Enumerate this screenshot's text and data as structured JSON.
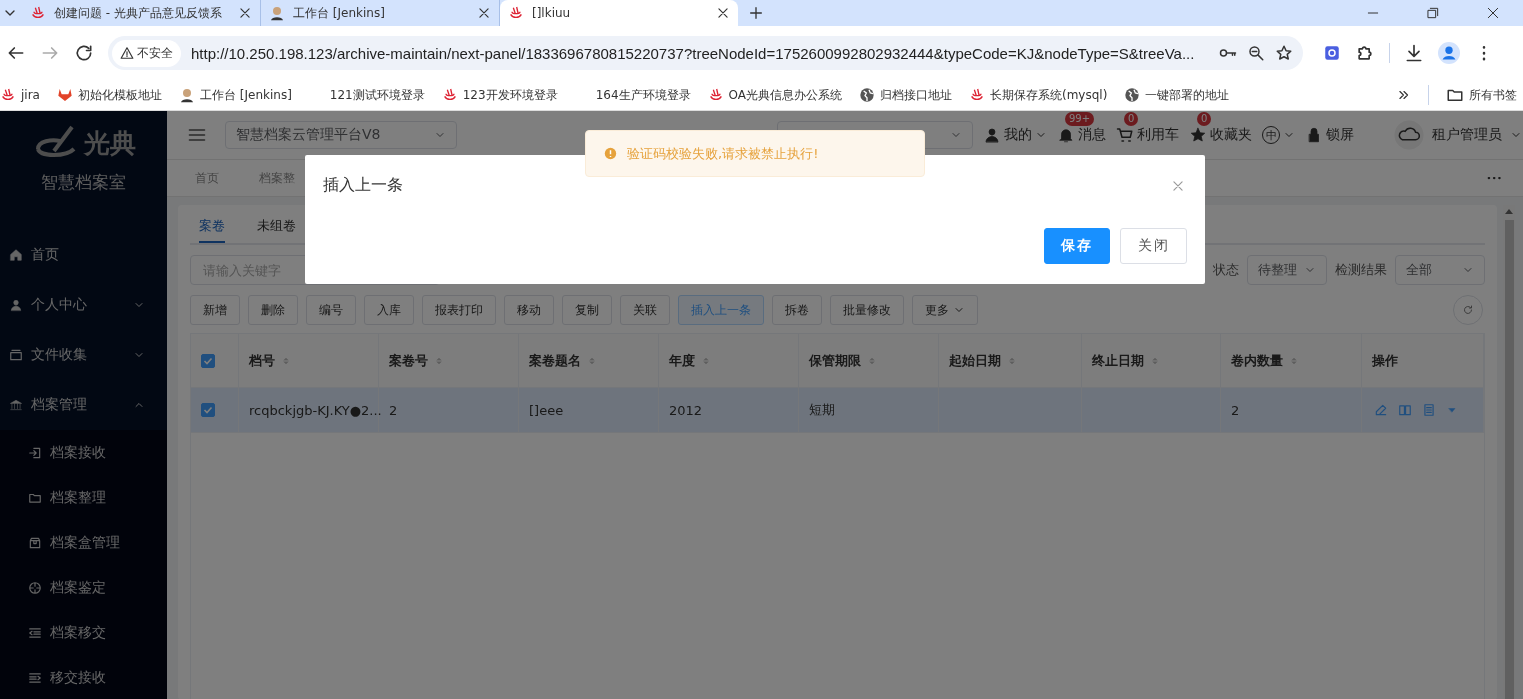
{
  "browser": {
    "tabs": [
      {
        "kind": "logo",
        "title": "创建问题 - 光典产品意见反馈系",
        "selected": false
      },
      {
        "kind": "avatar",
        "title": "工作台 [Jenkins]",
        "selected": false
      },
      {
        "kind": "logo",
        "title": "[]lkiuu",
        "selected": true
      }
    ],
    "security": "不安全",
    "url": "http://10.250.198.123/archive-maintain/next-panel/1833696780815220737?treeNodeId=1752600992802932444&typeCode=KJ&nodeType=S&treeVa...",
    "bookmarks": [
      {
        "kind": "logo",
        "label": "jira"
      },
      {
        "kind": "fox",
        "label": "初始化模板地址"
      },
      {
        "kind": "avatar",
        "label": "工作台 [Jenkins]"
      },
      {
        "kind": "none",
        "label": "121测试环境登录"
      },
      {
        "kind": "logo",
        "label": "123开发环境登录"
      },
      {
        "kind": "none",
        "label": "164生产环境登录"
      },
      {
        "kind": "logo",
        "label": "OA光典信息办公系统"
      },
      {
        "kind": "globe",
        "label": "归档接口地址"
      },
      {
        "kind": "logo",
        "label": "长期保存系统(mysql)"
      },
      {
        "kind": "globe",
        "label": "一键部署的地址"
      }
    ],
    "all_bookmarks": "所有书签"
  },
  "sidebar": {
    "logo": "光典",
    "title": "智慧档案室",
    "items": [
      {
        "kind": "home",
        "label": "首页"
      },
      {
        "kind": "person",
        "label": "个人中心",
        "expanded": false
      },
      {
        "kind": "tray",
        "label": "文件收集",
        "expanded": false
      },
      {
        "kind": "bank",
        "label": "档案管理",
        "expanded": true,
        "children": [
          {
            "kind": "enter",
            "label": "档案接收"
          },
          {
            "kind": "folder",
            "label": "档案整理"
          },
          {
            "kind": "box",
            "label": "档案盒管理"
          },
          {
            "kind": "crosshair",
            "label": "档案鉴定"
          },
          {
            "kind": "outdent",
            "label": "档案移交"
          },
          {
            "kind": "indent",
            "label": "移交接收"
          }
        ]
      }
    ]
  },
  "header": {
    "system": "智慧档案云管理平台V8",
    "menu": [
      {
        "kind": "user",
        "label": "我的",
        "dropdown": true
      },
      {
        "kind": "bell",
        "label": "消息",
        "badge": "99+"
      },
      {
        "kind": "cart",
        "label": "利用车",
        "badge": "0"
      },
      {
        "kind": "star",
        "label": "收藏夹",
        "badge": "0"
      },
      {
        "kind": "language",
        "label": "中",
        "dropdown": true
      },
      {
        "kind": "lock",
        "label": "锁屏"
      }
    ],
    "user": "租户管理员"
  },
  "page_tabs": [
    "首页",
    "档案整"
  ],
  "content": {
    "tabs": [
      {
        "label": "案卷",
        "selected": true
      },
      {
        "label": "未组卷",
        "selected": false
      }
    ],
    "search": {
      "placeholder": "请输入关键字"
    },
    "filters": [
      {
        "label": "状态",
        "value": "待整理"
      },
      {
        "label": "检测结果",
        "value": "全部"
      }
    ],
    "toolbar": [
      {
        "label": "新增",
        "selected": false
      },
      {
        "label": "删除",
        "selected": false
      },
      {
        "label": "编号",
        "selected": false
      },
      {
        "label": "入库",
        "selected": false
      },
      {
        "label": "报表打印",
        "selected": false
      },
      {
        "label": "移动",
        "selected": false
      },
      {
        "label": "复制",
        "selected": false
      },
      {
        "label": "关联",
        "selected": false
      },
      {
        "label": "插入上一条",
        "selected": true
      },
      {
        "label": "拆卷",
        "selected": false
      },
      {
        "label": "批量修改",
        "selected": false
      },
      {
        "label": "更多",
        "selected": false,
        "dropdown": true
      }
    ],
    "table": {
      "all_checked": true,
      "columns": [
        {
          "label": "档号",
          "sortable": true
        },
        {
          "label": "案卷号",
          "sortable": true
        },
        {
          "label": "案卷题名",
          "sortable": true
        },
        {
          "label": "年度",
          "sortable": true
        },
        {
          "label": "保管期限",
          "sortable": true
        },
        {
          "label": "起始日期",
          "sortable": true
        },
        {
          "label": "终止日期",
          "sortable": true
        },
        {
          "label": "卷内数量",
          "sortable": true
        },
        {
          "label": "操作",
          "sortable": false
        }
      ],
      "rows": [
        {
          "checked": true,
          "selected": true,
          "cells": [
            "rcqbckjgb-KJ.KY●2...",
            "2",
            "[]eee",
            "2012",
            "短期",
            null,
            null,
            "2"
          ]
        }
      ]
    }
  },
  "dialog": {
    "title": "插入上一条",
    "buttons": [
      {
        "kind": "primary",
        "label": "保存"
      },
      {
        "kind": "default",
        "label": "关闭"
      }
    ]
  },
  "toast": {
    "kind": "warning",
    "message": "验证码校验失败,请求被禁止执行!"
  }
}
